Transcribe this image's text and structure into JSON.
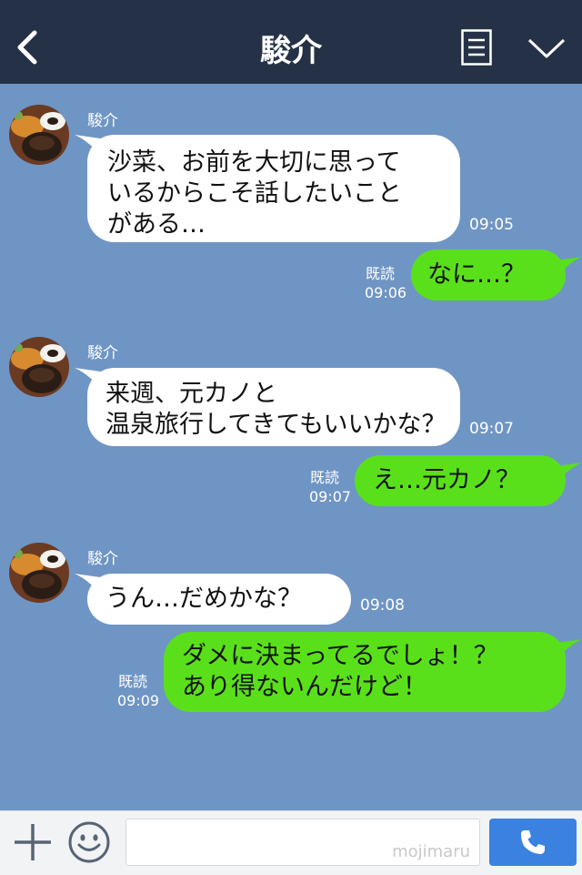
{
  "header": {
    "title": "駿介",
    "icons": [
      "back-icon",
      "list-icon",
      "chevron-down-icon"
    ]
  },
  "messages": [
    {
      "sender": "駿介",
      "side": "incoming",
      "text": "沙菜、お前を大切に思って\nいるからこそ話したいこと\nがある…",
      "time": "09:05"
    },
    {
      "side": "outgoing",
      "text": "なに…？",
      "read": "既読",
      "time": "09:06"
    },
    {
      "sender": "駿介",
      "side": "incoming",
      "text": "来週、元カノと\n温泉旅行してきてもいいかな？",
      "time": "09:07"
    },
    {
      "side": "outgoing",
      "text": "え…元カノ？",
      "read": "既読",
      "time": "09:07"
    },
    {
      "sender": "駿介",
      "side": "incoming",
      "text": "うん…だめかな？",
      "time": "09:08"
    },
    {
      "side": "outgoing",
      "text": "ダメに決まってるでしょ！？\nあり得ないんだけど！",
      "read": "既読",
      "time": "09:09"
    }
  ],
  "composer": {
    "watermark": "mojimaru",
    "icons": [
      "plus-icon",
      "smile-icon",
      "phone-icon"
    ]
  },
  "colors": {
    "header_bg": "#253146",
    "chat_bg": "#6f95c4",
    "incoming_bubble": "#ffffff",
    "outgoing_bubble": "#5ae01a",
    "call_button": "#3b82e0"
  }
}
